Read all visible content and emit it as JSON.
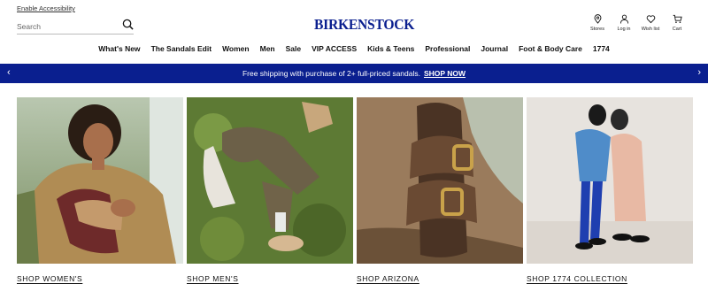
{
  "header": {
    "accessibility_label": "Enable Accessibility",
    "search_placeholder": "Search",
    "logo": "BIRKENSTOCK",
    "utilities": [
      {
        "label": "Stores",
        "icon": "location-pin-icon"
      },
      {
        "label": "Log in",
        "icon": "user-icon"
      },
      {
        "label": "Wish list",
        "icon": "heart-icon"
      },
      {
        "label": "Cart",
        "icon": "cart-icon"
      }
    ]
  },
  "nav": {
    "items": [
      "What's New",
      "The Sandals Edit",
      "Women",
      "Men",
      "Sale",
      "VIP ACCESS",
      "Kids & Teens",
      "Professional",
      "Journal",
      "Foot & Body Care",
      "1774"
    ]
  },
  "banner": {
    "text": "Free shipping with purchase of 2+ full-priced sandals.",
    "link": "SHOP NOW",
    "color": "#0a1f8f"
  },
  "tiles": [
    {
      "label": "SHOP WOMEN'S",
      "image": "woman-holding-sandals-photo"
    },
    {
      "label": "SHOP MEN'S",
      "image": "man-on-grass-clogs-photo"
    },
    {
      "label": "SHOP ARIZONA",
      "image": "arizona-sandal-photo"
    },
    {
      "label": "SHOP 1774 COLLECTION",
      "image": "1774-collection-models-photo"
    }
  ]
}
